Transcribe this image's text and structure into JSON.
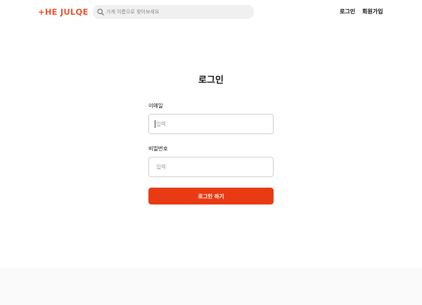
{
  "header": {
    "logo": "+HE JULQE",
    "search_placeholder": "가게 이름으로 찾아보세요",
    "nav": {
      "login": "로그인",
      "signup": "회원가입"
    }
  },
  "login_form": {
    "title": "로그인",
    "email_label": "이메일",
    "email_placeholder": "입력",
    "password_label": "비밀번호",
    "password_placeholder": "입력",
    "submit_label": "로그인 하기"
  },
  "colors": {
    "brand": "#e6542d",
    "primary_button": "#e83b14"
  },
  "icons": {
    "search": "search-icon"
  }
}
